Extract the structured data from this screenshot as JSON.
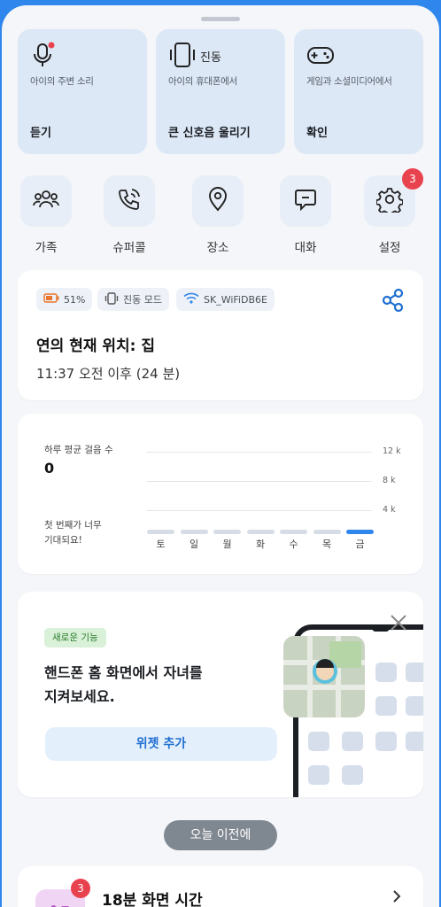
{
  "actions": [
    {
      "icon": "microphone-icon",
      "subtitle": "아이의 주변 소리",
      "label": "듣기",
      "tag": ""
    },
    {
      "icon": "phone-vibrate-icon",
      "subtitle": "아이의 휴대폰에서",
      "label": "큰 신호음 울리기",
      "tag": "진동"
    },
    {
      "icon": "gamepad-icon",
      "subtitle": "게임과 소셜미디어에서",
      "label": "확인",
      "tag": ""
    }
  ],
  "shortcuts": [
    {
      "icon": "family-icon",
      "label": "가족"
    },
    {
      "icon": "super-call-icon",
      "label": "슈퍼콜"
    },
    {
      "icon": "location-pin-icon",
      "label": "장소"
    },
    {
      "icon": "chat-icon",
      "label": "대화"
    },
    {
      "icon": "gear-icon",
      "label": "설정",
      "badge": "3"
    }
  ],
  "location": {
    "battery": "51%",
    "mode": "진동 모드",
    "wifi": "SK_WiFiDB6E",
    "title": "연의 현재 위치: 집",
    "time": "11:37 오전 이후 (24 분)"
  },
  "steps": {
    "label": "하루 평균 걸음 수",
    "value": "0",
    "expect_line1": "첫 번째가 너무",
    "expect_line2": "기대되요!"
  },
  "chart_data": {
    "type": "bar",
    "categories": [
      "토",
      "일",
      "월",
      "화",
      "수",
      "목",
      "금"
    ],
    "values": [
      0,
      0,
      0,
      0,
      0,
      0,
      0
    ],
    "ytick_labels": [
      "12 k",
      "8 k",
      "4 k"
    ],
    "highlight": "금"
  },
  "promo": {
    "tag": "새로운 기능",
    "line1": "핸드폰 홈 화면에서 자녀를",
    "line2": "지켜보세요.",
    "button": "위젯 추가"
  },
  "previous_button": "오늘 이전에",
  "screen_time": {
    "title": "18분 화면 시간",
    "badge": "3"
  },
  "colors": {
    "accent": "#2f86ec",
    "badge": "#e9424f"
  }
}
